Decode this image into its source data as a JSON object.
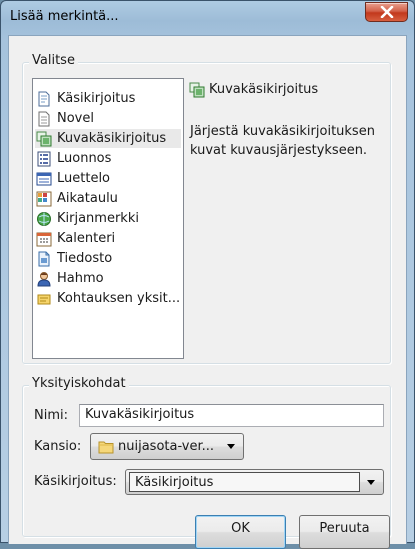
{
  "window": {
    "title": "Lisää merkintä..."
  },
  "select_group": {
    "label": "Valitse",
    "items": [
      {
        "label": "Käsikirjoitus",
        "icon": "script-page-icon"
      },
      {
        "label": "Novel",
        "icon": "novel-page-icon"
      },
      {
        "label": "Kuvakäsikirjoitus",
        "icon": "storyboard-icon",
        "selected": true
      },
      {
        "label": "Luonnos",
        "icon": "outline-icon"
      },
      {
        "label": "Luettelo",
        "icon": "list-icon"
      },
      {
        "label": "Aikataulu",
        "icon": "schedule-icon"
      },
      {
        "label": "Kirjanmerkki",
        "icon": "bookmark-globe-icon"
      },
      {
        "label": "Kalenteri",
        "icon": "calendar-icon"
      },
      {
        "label": "Tiedosto",
        "icon": "file-icon"
      },
      {
        "label": "Hahmo",
        "icon": "character-icon"
      },
      {
        "label": "Kohtauksen yksit...",
        "icon": "scene-detail-icon"
      }
    ],
    "detail_title": "Kuvakäsikirjoitus",
    "detail_description": "Järjestä kuvakäsikirjoituksen kuvat kuvausjärjestykseen."
  },
  "details_group": {
    "label": "Yksityiskohdat",
    "name_label": "Nimi:",
    "name_value": "Kuvakäsikirjoitus",
    "folder_label": "Kansio:",
    "folder_value": "nuijasota-ver...",
    "script_label": "Käsikirjoitus:",
    "script_value": "Käsikirjoitus"
  },
  "buttons": {
    "ok": "OK",
    "cancel": "Peruuta"
  },
  "colors": {
    "selection": "#e9e9e9",
    "title_bg": "#a6c3dd",
    "close_red": "#c2381c"
  }
}
